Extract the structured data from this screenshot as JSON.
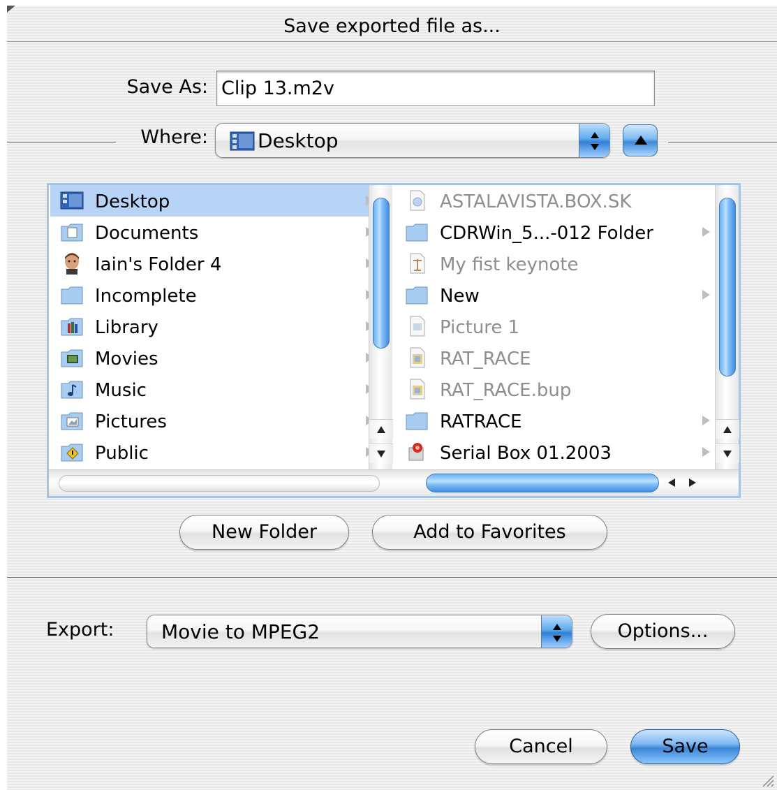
{
  "window": {
    "title": "Save exported file as..."
  },
  "save_as": {
    "label": "Save As:",
    "value": "Clip 13.m2v"
  },
  "where": {
    "label": "Where:",
    "selected": "Desktop"
  },
  "browser": {
    "column1": [
      {
        "label": "Desktop",
        "icon": "desktop-icon",
        "selected": true,
        "has_children": true
      },
      {
        "label": "Documents",
        "icon": "documents-folder-icon",
        "selected": false,
        "has_children": true
      },
      {
        "label": "Iain's Folder 4",
        "icon": "user-face-icon",
        "selected": false,
        "has_children": true
      },
      {
        "label": "Incomplete",
        "icon": "folder-icon",
        "selected": false,
        "has_children": true
      },
      {
        "label": "Library",
        "icon": "library-folder-icon",
        "selected": false,
        "has_children": true
      },
      {
        "label": "Movies",
        "icon": "movies-folder-icon",
        "selected": false,
        "has_children": true
      },
      {
        "label": "Music",
        "icon": "music-folder-icon",
        "selected": false,
        "has_children": true
      },
      {
        "label": "Pictures",
        "icon": "pictures-folder-icon",
        "selected": false,
        "has_children": true
      },
      {
        "label": "Public",
        "icon": "public-folder-icon",
        "selected": false,
        "has_children": true
      }
    ],
    "column2": [
      {
        "label": "ASTALAVISTA.BOX.SK",
        "icon": "document-icon",
        "disabled": true,
        "has_children": false
      },
      {
        "label": "CDRWin_5...-012 Folder",
        "icon": "folder-icon",
        "disabled": false,
        "has_children": true
      },
      {
        "label": "My fist keynote",
        "icon": "keynote-document-icon",
        "disabled": true,
        "has_children": false
      },
      {
        "label": "New",
        "icon": "folder-icon",
        "disabled": false,
        "has_children": true
      },
      {
        "label": "Picture 1",
        "icon": "image-document-icon",
        "disabled": true,
        "has_children": false
      },
      {
        "label": "RAT_RACE",
        "icon": "application-document-icon",
        "disabled": true,
        "has_children": false
      },
      {
        "label": "RAT_RACE.bup",
        "icon": "application-document-icon",
        "disabled": true,
        "has_children": false
      },
      {
        "label": "RATRACE",
        "icon": "folder-icon",
        "disabled": false,
        "has_children": true
      },
      {
        "label": "Serial Box 01.2003",
        "icon": "serial-box-icon",
        "disabled": false,
        "has_children": true
      }
    ]
  },
  "buttons": {
    "new_folder": "New Folder",
    "add_favorites": "Add to Favorites",
    "options": "Options...",
    "cancel": "Cancel",
    "save": "Save"
  },
  "export": {
    "label": "Export:",
    "selected": "Movie to MPEG2"
  },
  "colors": {
    "selection": "#b7d3f6",
    "aqua_blue": "#3b86d6",
    "disabled_text": "#8e8e8e"
  }
}
